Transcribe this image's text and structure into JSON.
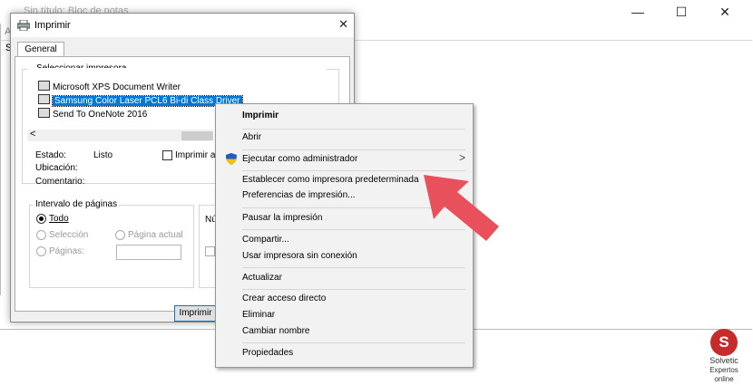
{
  "notepad": {
    "title": "Sin título: Bloc de notas",
    "menu_fragment": "A",
    "content_fragment": "S",
    "controls": {
      "minimize": "—",
      "maximize": "☐",
      "close": "✕"
    }
  },
  "dialog": {
    "title": "Imprimir",
    "close": "✕",
    "tab": "General",
    "select_printer_group": "Seleccionar impresora",
    "printers": [
      "Microsoft XPS Document Writer",
      "Samsung Color Laser PCL6 Bi-di Class Driver",
      "Send To OneNote 2016"
    ],
    "selected_printer_index": 1,
    "status_label": "Estado:",
    "status_value": "Listo",
    "location_label": "Ubicación:",
    "comment_label": "Comentario:",
    "print_to_file": "Imprimir a un",
    "page_range_group": "Intervalo de páginas",
    "range_all": "Todo",
    "range_selection": "Selección",
    "range_current": "Página actual",
    "range_pages": "Páginas:",
    "copies_fragment": "Nú",
    "print_button": "Imprimir",
    "scroll_left": "<"
  },
  "context_menu": {
    "items": [
      {
        "label": "Imprimir",
        "bold": true
      },
      {
        "label": "Abrir"
      },
      {
        "label": "Ejecutar como administrador",
        "has_submenu": true,
        "icon": "uac-shield-icon"
      },
      {
        "label": "Establecer como impresora predeterminada"
      },
      {
        "label": "Preferencias de impresión..."
      },
      {
        "label": "Pausar la impresión"
      },
      {
        "label": "Compartir..."
      },
      {
        "label": "Usar impresora sin conexión"
      },
      {
        "label": "Actualizar"
      },
      {
        "label": "Crear acceso directo"
      },
      {
        "label": "Eliminar"
      },
      {
        "label": "Cambiar nombre"
      },
      {
        "label": "Propiedades"
      }
    ],
    "submenu_arrow": ">"
  },
  "watermark": {
    "letter": "S",
    "line1": "Solvetic",
    "line2": "Expertos online"
  },
  "colors": {
    "selection": "#0078d7",
    "annotation_arrow": "#e8505b",
    "shield_blue": "#1f5bc6",
    "shield_yellow": "#f2c300"
  }
}
